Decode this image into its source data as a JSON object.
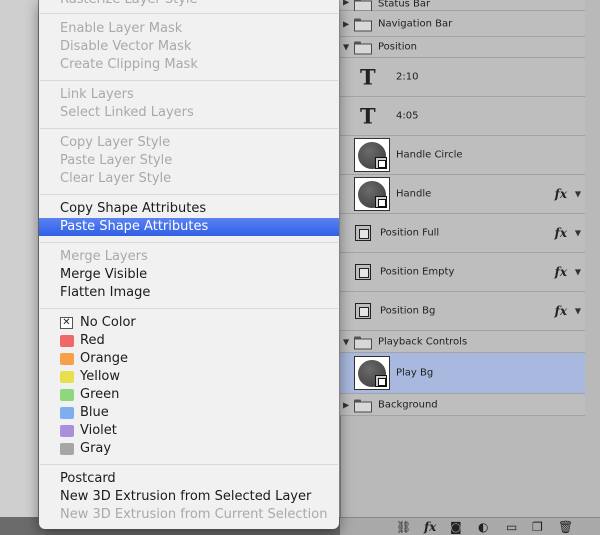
{
  "menu": {
    "items": [
      {
        "label": "Rasterize Layer Style",
        "enabled": false
      },
      {
        "label": "Enable Layer Mask",
        "enabled": false
      },
      {
        "label": "Disable Vector Mask",
        "enabled": false
      },
      {
        "label": "Create Clipping Mask",
        "enabled": false
      },
      {
        "label": "Link Layers",
        "enabled": false
      },
      {
        "label": "Select Linked Layers",
        "enabled": false
      },
      {
        "label": "Copy Layer Style",
        "enabled": false
      },
      {
        "label": "Paste Layer Style",
        "enabled": false
      },
      {
        "label": "Clear Layer Style",
        "enabled": false
      },
      {
        "label": "Copy Shape Attributes",
        "enabled": true
      },
      {
        "label": "Paste Shape Attributes",
        "enabled": true,
        "highlighted": true
      },
      {
        "label": "Merge Layers",
        "enabled": false
      },
      {
        "label": "Merge Visible",
        "enabled": true
      },
      {
        "label": "Flatten Image",
        "enabled": true
      },
      {
        "label": "No Color",
        "enabled": true
      },
      {
        "label": "Red",
        "enabled": true,
        "color": "#f0696a"
      },
      {
        "label": "Orange",
        "enabled": true,
        "color": "#f6a14a"
      },
      {
        "label": "Yellow",
        "enabled": true,
        "color": "#e7e04e"
      },
      {
        "label": "Green",
        "enabled": true,
        "color": "#8fd77c"
      },
      {
        "label": "Blue",
        "enabled": true,
        "color": "#7faef0"
      },
      {
        "label": "Violet",
        "enabled": true,
        "color": "#a98fdc"
      },
      {
        "label": "Gray",
        "enabled": true,
        "color": "#a6a6a6"
      },
      {
        "label": "Postcard",
        "enabled": true
      },
      {
        "label": "New 3D Extrusion from Selected Layer",
        "enabled": true
      },
      {
        "label": "New 3D Extrusion from Current Selection",
        "enabled": false
      }
    ],
    "highlight_color": "#3d6ae9"
  },
  "layers": {
    "rows": [
      {
        "label": "Status Bar",
        "kind": "group"
      },
      {
        "label": "Navigation Bar",
        "kind": "group"
      },
      {
        "label": "Position",
        "kind": "group-open"
      },
      {
        "label": "2:10",
        "kind": "text"
      },
      {
        "label": "4:05",
        "kind": "text"
      },
      {
        "label": "Handle Circle",
        "kind": "shape-thumb"
      },
      {
        "label": "Handle",
        "kind": "shape-thumb",
        "fx": "fx"
      },
      {
        "label": "Position Full",
        "kind": "shape",
        "fx": "fx"
      },
      {
        "label": "Position Empty",
        "kind": "shape",
        "fx": "fx"
      },
      {
        "label": "Position Bg",
        "kind": "shape",
        "fx": "fx"
      },
      {
        "label": "Playback Controls",
        "kind": "group-open"
      },
      {
        "label": "Play Bg",
        "kind": "shape-thumb",
        "selected": true
      },
      {
        "label": "Background",
        "kind": "group"
      }
    ],
    "selected_color": "#a8b8de",
    "text_glyph": "T"
  },
  "toolbar": {
    "icons": [
      "link-icon",
      "fx-icon",
      "mask-icon",
      "adjustment-icon",
      "folder-icon",
      "new-layer-icon",
      "trash-icon"
    ],
    "fx_label": "fx"
  }
}
